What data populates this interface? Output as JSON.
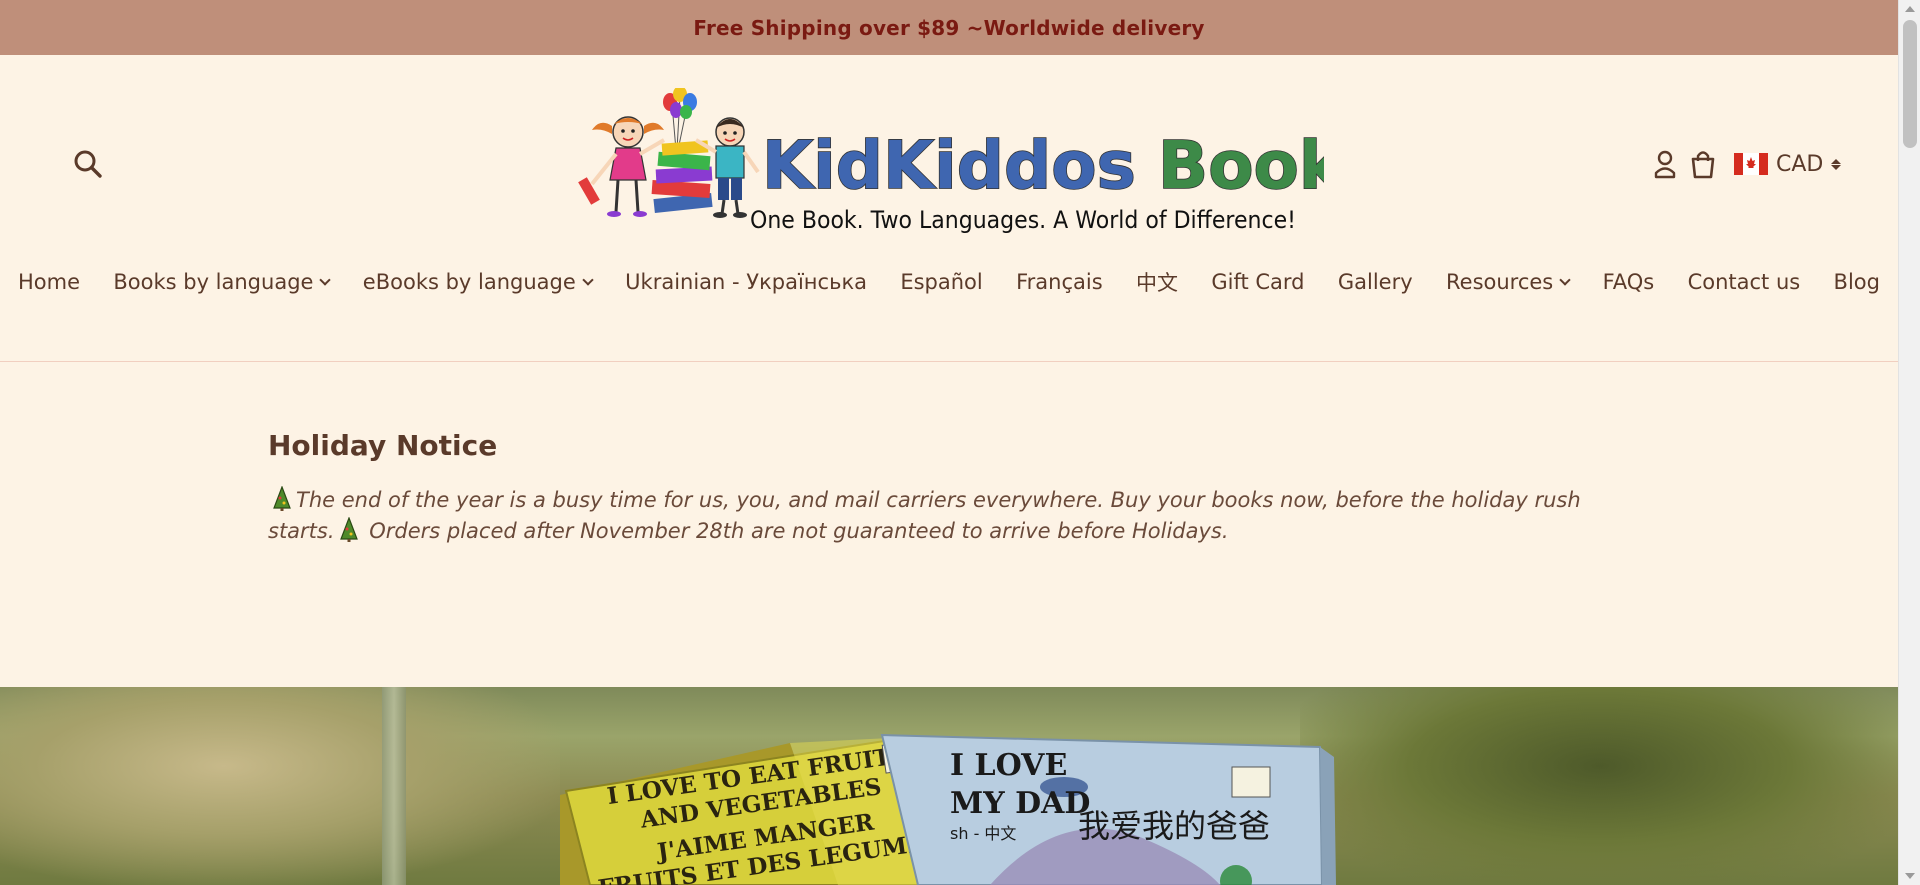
{
  "announcement": {
    "text": "Free Shipping over $89 ~Worldwide delivery"
  },
  "header": {
    "logo": {
      "brand_part1": "KidKiddos",
      "brand_part2": "Books",
      "tagline": "One Book. Two Languages. A World of Difference!"
    },
    "currency": {
      "code": "CAD",
      "flag": "canada-flag"
    },
    "icons": [
      "search-icon",
      "account-icon",
      "cart-icon"
    ]
  },
  "nav": {
    "items": [
      {
        "label": "Home",
        "dropdown": false
      },
      {
        "label": "Books by language",
        "dropdown": true
      },
      {
        "label": "eBooks by language",
        "dropdown": true
      },
      {
        "label": "Ukrainian - Українська",
        "dropdown": false
      },
      {
        "label": "Español",
        "dropdown": false
      },
      {
        "label": "Français",
        "dropdown": false
      },
      {
        "label": "中文",
        "dropdown": false
      },
      {
        "label": "Gift Card",
        "dropdown": false
      },
      {
        "label": "Gallery",
        "dropdown": false
      },
      {
        "label": "Resources",
        "dropdown": true
      },
      {
        "label": "FAQs",
        "dropdown": false
      },
      {
        "label": "Contact us",
        "dropdown": false
      },
      {
        "label": "Blog",
        "dropdown": false
      }
    ]
  },
  "notice": {
    "title": "Holiday Notice",
    "line1_text": "The end of the year is a busy time for us, you, and mail carriers everywhere. Buy your books now, before the holiday rush starts.",
    "line2_text": " Orders placed after November 28th are not guaranteed to arrive before Holidays."
  },
  "hero": {
    "book1": {
      "title_line1": "I LOVE TO EAT FRUITS",
      "title_line2": "AND VEGETABLES",
      "title_line3": "J'AIME MANGER",
      "title_line4": "FRUITS ET DES LEGUMES"
    },
    "book2": {
      "title_line1": "I LOVE",
      "title_line2": "MY DAD",
      "subtitle": "sh - 中文",
      "chinese_title": "我爱我的爸爸"
    }
  },
  "colors": {
    "announcement_bg": "#bf8f7a",
    "announcement_text": "#7a1a12",
    "page_bg": "#fdf3e5",
    "text": "#5a3a2a",
    "logo_blue": "#3f66b0",
    "logo_red": "#c8504a",
    "logo_green": "#3d8a48"
  }
}
